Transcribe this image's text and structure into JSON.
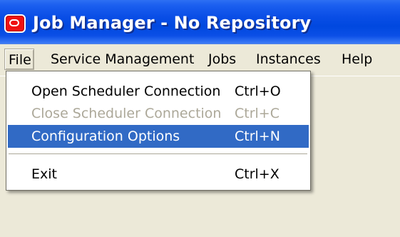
{
  "window": {
    "title": "Job Manager - No Repository",
    "app_icon": "oracle-logo-icon"
  },
  "menubar": {
    "items": [
      {
        "label": "File",
        "state": "open"
      },
      {
        "label": "Service Management"
      },
      {
        "label": "Jobs"
      },
      {
        "label": "Instances"
      },
      {
        "label": "Help"
      }
    ]
  },
  "file_menu": {
    "items": [
      {
        "label": "Open Scheduler Connection",
        "shortcut": "Ctrl+O",
        "enabled": true
      },
      {
        "label": "Close Scheduler Connection",
        "shortcut": "Ctrl+C",
        "enabled": false
      },
      {
        "label": "Configuration Options",
        "shortcut": "Ctrl+N",
        "enabled": true,
        "highlighted": true
      },
      {
        "label": "Exit",
        "shortcut": "Ctrl+X",
        "enabled": true
      }
    ]
  },
  "colors": {
    "titlebar": "#0a4ee6",
    "menu_highlight": "#316ac5",
    "disabled_text": "#aca899",
    "window_background": "#ece9d8",
    "logo": "#ef1111"
  }
}
